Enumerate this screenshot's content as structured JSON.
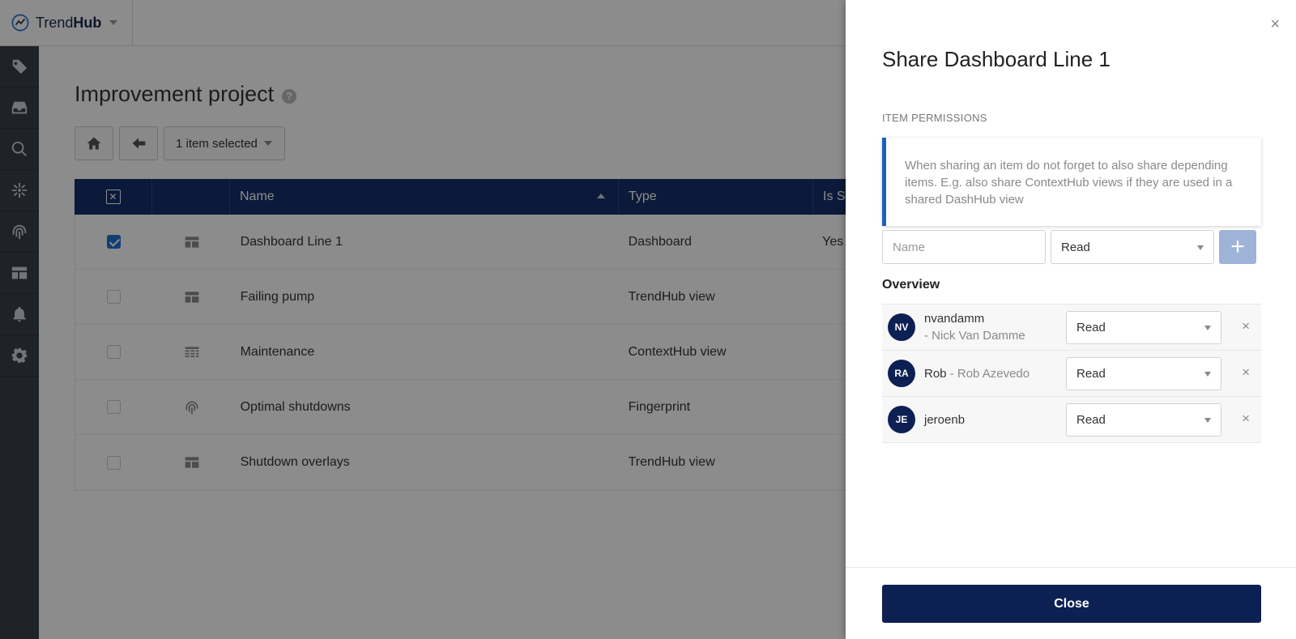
{
  "app": {
    "brand_light": "Trend",
    "brand_bold": "Hub"
  },
  "sidebar": {
    "items": [
      {
        "icon": "tag-icon"
      },
      {
        "icon": "inbox-icon"
      },
      {
        "icon": "search-icon"
      },
      {
        "icon": "network-icon"
      },
      {
        "icon": "fingerprint-icon"
      },
      {
        "icon": "dashboard-icon"
      },
      {
        "icon": "bell-icon"
      },
      {
        "icon": "gear-icon"
      }
    ]
  },
  "main": {
    "title": "Improvement project",
    "help": "?",
    "toolbar": {
      "selection_label": "1 item selected"
    },
    "table": {
      "columns": [
        "",
        "",
        "Name",
        "Type",
        "Is Sh"
      ],
      "rows": [
        {
          "checked": true,
          "icon": "dashboard-icon",
          "name": "Dashboard Line 1",
          "type": "Dashboard",
          "shared": "Yes"
        },
        {
          "checked": false,
          "icon": "dashboard-icon",
          "name": "Failing pump",
          "type": "TrendHub view",
          "shared": ""
        },
        {
          "checked": false,
          "icon": "table-icon",
          "name": "Maintenance",
          "type": "ContextHub view",
          "shared": ""
        },
        {
          "checked": false,
          "icon": "fingerprint-icon",
          "name": "Optimal shutdowns",
          "type": "Fingerprint",
          "shared": ""
        },
        {
          "checked": false,
          "icon": "dashboard-icon",
          "name": "Shutdown overlays",
          "type": "TrendHub view",
          "shared": ""
        }
      ]
    }
  },
  "share": {
    "title": "Share Dashboard Line 1",
    "close_icon": "×",
    "section_label": "ITEM PERMISSIONS",
    "notice": "When sharing an item do not forget to also share depending items. E.g. also share ContextHub views if they are used in a shared DashHub view",
    "name_placeholder": "Name",
    "permission_value": "Read",
    "add_icon": "+",
    "overview_label": "Overview",
    "users": [
      {
        "initials": "NV",
        "username": "nvandamm",
        "fullname": "- Nick Van Damme",
        "permission": "Read"
      },
      {
        "initials": "RA",
        "username": "Rob",
        "fullname": " - Rob Azevedo",
        "permission": "Read"
      },
      {
        "initials": "JE",
        "username": "jeroenb",
        "fullname": "",
        "permission": "Read"
      }
    ],
    "remove_icon": "×",
    "close_label": "Close"
  },
  "colors": {
    "header_navy": "#14306a",
    "button_navy": "#0d2054",
    "accent_blue": "#1f5fc0",
    "sidebar": "#3a3f47"
  }
}
